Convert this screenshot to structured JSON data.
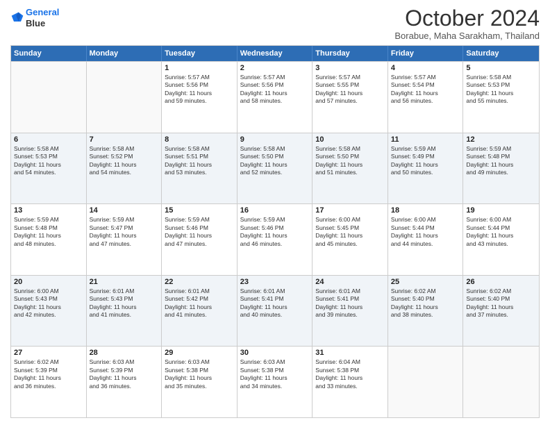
{
  "header": {
    "logo_line1": "General",
    "logo_line2": "Blue",
    "month": "October 2024",
    "location": "Borabue, Maha Sarakham, Thailand"
  },
  "weekdays": [
    "Sunday",
    "Monday",
    "Tuesday",
    "Wednesday",
    "Thursday",
    "Friday",
    "Saturday"
  ],
  "rows": [
    [
      {
        "day": "",
        "text": "",
        "empty": true
      },
      {
        "day": "",
        "text": "",
        "empty": true
      },
      {
        "day": "1",
        "text": "Sunrise: 5:57 AM\nSunset: 5:56 PM\nDaylight: 11 hours\nand 59 minutes."
      },
      {
        "day": "2",
        "text": "Sunrise: 5:57 AM\nSunset: 5:56 PM\nDaylight: 11 hours\nand 58 minutes."
      },
      {
        "day": "3",
        "text": "Sunrise: 5:57 AM\nSunset: 5:55 PM\nDaylight: 11 hours\nand 57 minutes."
      },
      {
        "day": "4",
        "text": "Sunrise: 5:57 AM\nSunset: 5:54 PM\nDaylight: 11 hours\nand 56 minutes."
      },
      {
        "day": "5",
        "text": "Sunrise: 5:58 AM\nSunset: 5:53 PM\nDaylight: 11 hours\nand 55 minutes."
      }
    ],
    [
      {
        "day": "6",
        "text": "Sunrise: 5:58 AM\nSunset: 5:53 PM\nDaylight: 11 hours\nand 54 minutes."
      },
      {
        "day": "7",
        "text": "Sunrise: 5:58 AM\nSunset: 5:52 PM\nDaylight: 11 hours\nand 54 minutes."
      },
      {
        "day": "8",
        "text": "Sunrise: 5:58 AM\nSunset: 5:51 PM\nDaylight: 11 hours\nand 53 minutes."
      },
      {
        "day": "9",
        "text": "Sunrise: 5:58 AM\nSunset: 5:50 PM\nDaylight: 11 hours\nand 52 minutes."
      },
      {
        "day": "10",
        "text": "Sunrise: 5:58 AM\nSunset: 5:50 PM\nDaylight: 11 hours\nand 51 minutes."
      },
      {
        "day": "11",
        "text": "Sunrise: 5:59 AM\nSunset: 5:49 PM\nDaylight: 11 hours\nand 50 minutes."
      },
      {
        "day": "12",
        "text": "Sunrise: 5:59 AM\nSunset: 5:48 PM\nDaylight: 11 hours\nand 49 minutes."
      }
    ],
    [
      {
        "day": "13",
        "text": "Sunrise: 5:59 AM\nSunset: 5:48 PM\nDaylight: 11 hours\nand 48 minutes."
      },
      {
        "day": "14",
        "text": "Sunrise: 5:59 AM\nSunset: 5:47 PM\nDaylight: 11 hours\nand 47 minutes."
      },
      {
        "day": "15",
        "text": "Sunrise: 5:59 AM\nSunset: 5:46 PM\nDaylight: 11 hours\nand 47 minutes."
      },
      {
        "day": "16",
        "text": "Sunrise: 5:59 AM\nSunset: 5:46 PM\nDaylight: 11 hours\nand 46 minutes."
      },
      {
        "day": "17",
        "text": "Sunrise: 6:00 AM\nSunset: 5:45 PM\nDaylight: 11 hours\nand 45 minutes."
      },
      {
        "day": "18",
        "text": "Sunrise: 6:00 AM\nSunset: 5:44 PM\nDaylight: 11 hours\nand 44 minutes."
      },
      {
        "day": "19",
        "text": "Sunrise: 6:00 AM\nSunset: 5:44 PM\nDaylight: 11 hours\nand 43 minutes."
      }
    ],
    [
      {
        "day": "20",
        "text": "Sunrise: 6:00 AM\nSunset: 5:43 PM\nDaylight: 11 hours\nand 42 minutes."
      },
      {
        "day": "21",
        "text": "Sunrise: 6:01 AM\nSunset: 5:43 PM\nDaylight: 11 hours\nand 41 minutes."
      },
      {
        "day": "22",
        "text": "Sunrise: 6:01 AM\nSunset: 5:42 PM\nDaylight: 11 hours\nand 41 minutes."
      },
      {
        "day": "23",
        "text": "Sunrise: 6:01 AM\nSunset: 5:41 PM\nDaylight: 11 hours\nand 40 minutes."
      },
      {
        "day": "24",
        "text": "Sunrise: 6:01 AM\nSunset: 5:41 PM\nDaylight: 11 hours\nand 39 minutes."
      },
      {
        "day": "25",
        "text": "Sunrise: 6:02 AM\nSunset: 5:40 PM\nDaylight: 11 hours\nand 38 minutes."
      },
      {
        "day": "26",
        "text": "Sunrise: 6:02 AM\nSunset: 5:40 PM\nDaylight: 11 hours\nand 37 minutes."
      }
    ],
    [
      {
        "day": "27",
        "text": "Sunrise: 6:02 AM\nSunset: 5:39 PM\nDaylight: 11 hours\nand 36 minutes."
      },
      {
        "day": "28",
        "text": "Sunrise: 6:03 AM\nSunset: 5:39 PM\nDaylight: 11 hours\nand 36 minutes."
      },
      {
        "day": "29",
        "text": "Sunrise: 6:03 AM\nSunset: 5:38 PM\nDaylight: 11 hours\nand 35 minutes."
      },
      {
        "day": "30",
        "text": "Sunrise: 6:03 AM\nSunset: 5:38 PM\nDaylight: 11 hours\nand 34 minutes."
      },
      {
        "day": "31",
        "text": "Sunrise: 6:04 AM\nSunset: 5:38 PM\nDaylight: 11 hours\nand 33 minutes."
      },
      {
        "day": "",
        "text": "",
        "empty": true
      },
      {
        "day": "",
        "text": "",
        "empty": true
      }
    ]
  ]
}
